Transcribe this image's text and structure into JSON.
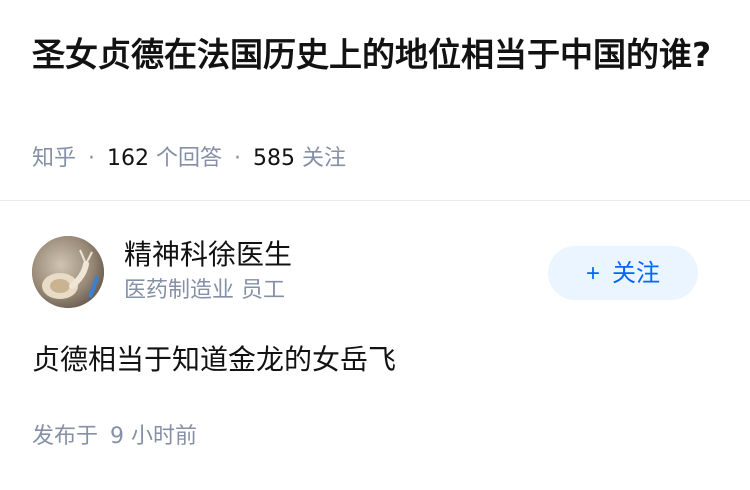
{
  "question": {
    "title": "圣女贞德在法国历史上的地位相当于中国的谁?",
    "meta": {
      "source": "知乎",
      "answer_count": "162",
      "answer_label": "个回答",
      "follow_count": "585",
      "follow_label": "关注"
    }
  },
  "answer": {
    "author": {
      "name": "精神科徐医生",
      "description": "医药制造业 员工"
    },
    "follow_button": {
      "icon": "+",
      "label": "关注"
    },
    "content": "贞德相当于知道金龙的女岳飞",
    "published_label": "发布于",
    "published_time": "9 小时前"
  }
}
